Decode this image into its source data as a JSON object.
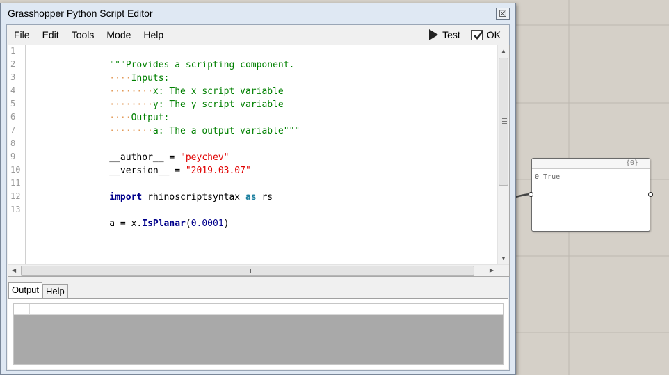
{
  "window": {
    "title": "Grasshopper Python Script Editor",
    "close_label": "☒"
  },
  "menubar": {
    "items": [
      "File",
      "Edit",
      "Tools",
      "Mode",
      "Help"
    ],
    "test_label": "Test",
    "ok_label": "OK"
  },
  "editor": {
    "line_numbers": [
      "1",
      "2",
      "3",
      "4",
      "5",
      "6",
      "7",
      "8",
      "9",
      "10",
      "11",
      "12",
      "13"
    ],
    "lines": {
      "l1_str": "\"\"\"Provides a scripting component.",
      "l2_dots": "····",
      "l2_str": "Inputs:",
      "l3_dots": "········",
      "l3_str": "x: The x script variable",
      "l4_dots": "········",
      "l4_str": "y: The y script variable",
      "l5_dots": "····",
      "l5_str": "Output:",
      "l6_dots": "········",
      "l6_str": "a: The a output variable\"\"\"",
      "l8_name": "__author__ = ",
      "l8_val": "\"peychev\"",
      "l9_name": "__version__ = ",
      "l9_val": "\"2019.03.07\"",
      "l11_kw": "import",
      "l11_mod": " rhinoscriptsyntax ",
      "l11_as": "as",
      "l11_alias": " rs",
      "l13_pre": "a = x.",
      "l13_fn": "IsPlanar",
      "l13_open": "(",
      "l13_num": "0.0001",
      "l13_close": ")"
    },
    "hscroll_grip": "III"
  },
  "output_pane": {
    "tabs": [
      "Output",
      "Help"
    ],
    "active_tab": "Output"
  },
  "panel": {
    "path": "{0}",
    "rows": [
      {
        "index": "0",
        "value": "True"
      }
    ]
  }
}
